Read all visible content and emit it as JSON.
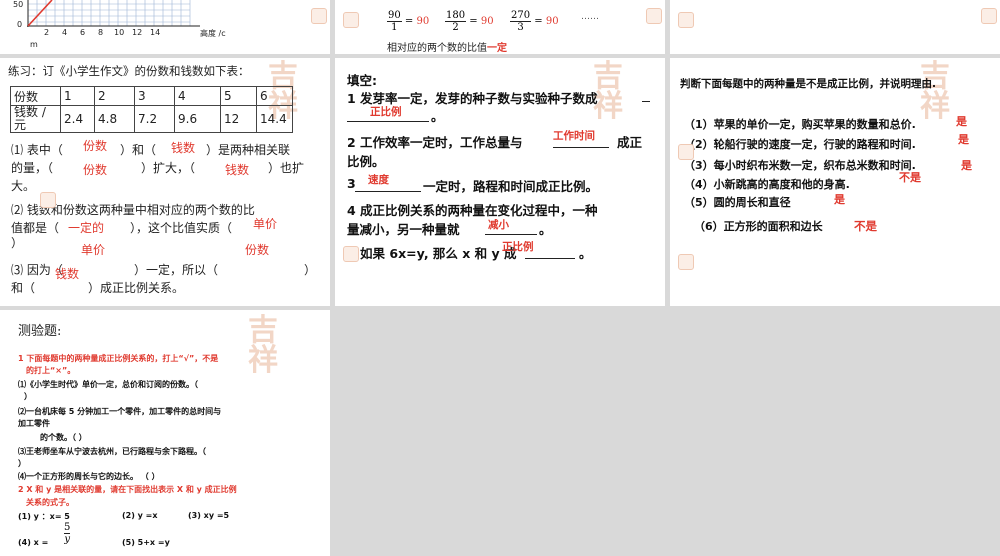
{
  "slide1": {
    "y_tick_50": "50",
    "y_tick_0": "0",
    "x_ticks": [
      "2",
      "4",
      "6",
      "8",
      "10",
      "12",
      "14"
    ],
    "x_axis_label": "高度 /c",
    "y_axis_label": "m"
  },
  "slide2": {
    "fractions": [
      {
        "num": "90",
        "den": "1",
        "result": "90"
      },
      {
        "num": "180",
        "den": "2",
        "result": "90"
      },
      {
        "num": "270",
        "den": "3",
        "result": "90"
      }
    ],
    "equals": "=",
    "ellipsis": "……",
    "conclusion_prefix": "相对应的两个数的比值",
    "conclusion_answer": "一定"
  },
  "slide4": {
    "intro": "练习：订《小学生作文》的份数和钱数如下表：",
    "table": {
      "row1_header": "份数",
      "row1_values": [
        "1",
        "2",
        "3",
        "4",
        "5",
        "6"
      ],
      "row2_header_line1": "钱数 /",
      "row2_header_line2": "元",
      "row2_values": [
        "2.4",
        "4.8",
        "7.2",
        "9.6",
        "12",
        "14.4"
      ]
    },
    "q1_a": "⑴ 表中（",
    "q1_b": "）和（",
    "q1_c": "）是两种相关联",
    "q1_d": "的量，（",
    "q1_e": "）扩大，（",
    "q1_f": "）也扩",
    "q1_g": "大。",
    "q1_ans1": "份数",
    "q1_ans2": "钱数",
    "q1_ans3": "份数",
    "q1_ans4": "钱数",
    "q2_a": "⑵ 钱数和份数这两种量中相对应的两个数的比",
    "q2_b": "值都是（",
    "q2_ans1": "一定的",
    "q2_c": "），这个比值实质（",
    "q2_ans2": "单价",
    "q2_d": "）",
    "q2_ans3": "单价",
    "q2_ans4": "份数",
    "q3_a": "⑶ 因为（",
    "q3_b": "）一定，所以（",
    "q3_c": "）",
    "q3_d": "和（",
    "q3_e": "）成正比例关系。",
    "q3_ans": "钱数"
  },
  "slide5": {
    "title": "填空:",
    "l1": "1 发芽率一定，发芽的种子数与实验种子数成",
    "l1_ans": "正比例",
    "l1_end": "。",
    "l2": "2 工作效率一定时，工作总量与",
    "l2_ans": "工作时间",
    "l2_end": "成正",
    "l2b": "比例。",
    "l3_num": "3",
    "l3_ans": "速度",
    "l3": "一定时，路程和时间成正比例。",
    "l4": "4 成正比例关系的两种量在变化过程中，一种",
    "l4b": "量减小，另一种量就",
    "l4_ans": "减小",
    "l4_end": "。",
    "l5": "5 如果 6x=y, 那么  x 和 y 成",
    "l5_ans": "正比例",
    "l5_end": "。"
  },
  "slide6": {
    "title": "判断下面每题中的两种量是不是成正比例，并说明理由.",
    "items": [
      {
        "text": "（1）苹果的单价一定，购买苹果的数量和总价.",
        "ans": "是"
      },
      {
        "text": "（2）轮船行驶的速度一定，行驶的路程和时间.",
        "ans": "是"
      },
      {
        "text": "（3）每小时织布米数一定，织布总米数和时间.",
        "ans": "是"
      },
      {
        "text": "（4）小新跳高的高度和他的身高.",
        "ans": "不是"
      },
      {
        "text": "（5）圆的周长和直径",
        "ans": "是"
      },
      {
        "text": "（6）正方形的面积和边长",
        "ans": "不是"
      }
    ]
  },
  "slide7": {
    "title": "测验题:",
    "q1_head_a": "1 下面每题中的两种量成正比例关系的，打上“√”，不是",
    "q1_head_b": "的打上“×”。",
    "i1": "⑴《小学生时代》单价一定，总价和订阅的份数。（",
    "i1b": "）",
    "i2": "⑵一台机床每 5 分钟加工一个零件，加工零件的总时间与",
    "i2b": "加工零件",
    "i2c": "的个数。（        ）",
    "i3": "⑶王老师坐车从宁波去杭州，已行路程与余下路程。（",
    "i3b": "）",
    "i4": "⑷一个正方形的周长与它的边长。  （        ）",
    "q2_head_a": "2 X 和 y 是相关联的量，请在下面找出表示 X 和 y 成正比例",
    "q2_head_b": "关系的式子。",
    "e1": "(1)      y ：x= 5",
    "e2": "(2)  y =x",
    "e3": "(3)    xy =5",
    "e4a": "(4)    x =",
    "e4_num": "5",
    "e4_den": "y",
    "e5": "(5)  5+x =y"
  },
  "colors": {
    "answer_red": "#e03a2f",
    "panel_gray": "#d9d9d9"
  }
}
